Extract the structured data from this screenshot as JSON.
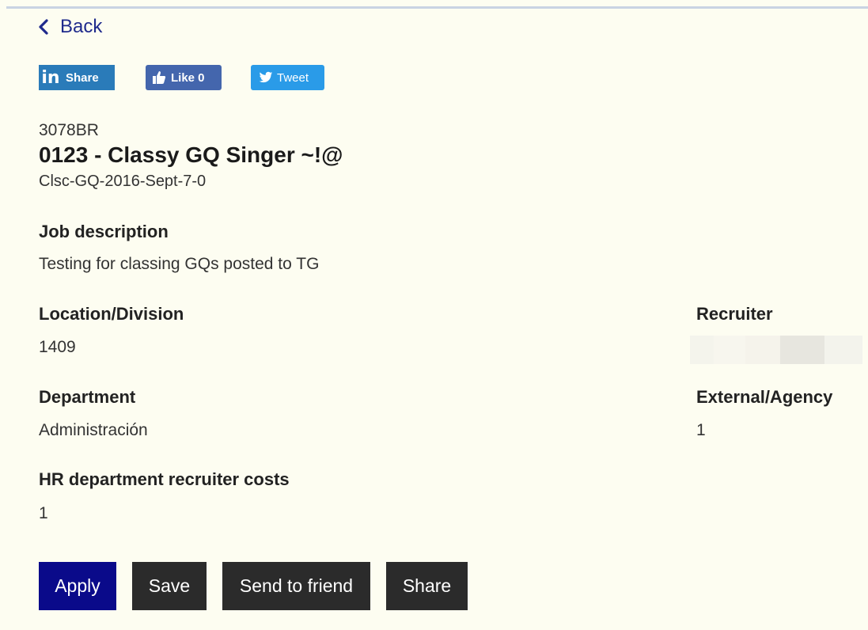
{
  "nav": {
    "back_label": "Back"
  },
  "social": {
    "linkedin_label": "Share",
    "facebook_label": "Like 0",
    "twitter_label": "Tweet",
    "colors": {
      "linkedin": "#2a7bb9",
      "facebook": "#4466ad",
      "twitter": "#2a9be8"
    }
  },
  "job": {
    "code": "3078BR",
    "title": "0123 - Classy GQ Singer ~!@",
    "reference": "Clsc-GQ-2016-Sept-7-0"
  },
  "fields": {
    "job_description": {
      "label": "Job description",
      "value": "Testing for classing GQs posted to TG"
    },
    "location_division": {
      "label": "Location/Division",
      "value": "1409"
    },
    "recruiter": {
      "label": "Recruiter",
      "value": ""
    },
    "department": {
      "label": "Department",
      "value": "Administración"
    },
    "external_agency": {
      "label": "External/Agency",
      "value": "1"
    },
    "hr_costs": {
      "label": "HR department recruiter costs",
      "value": "1"
    }
  },
  "actions": {
    "apply_label": "Apply",
    "save_label": "Save",
    "send_label": "Send to friend",
    "share_label": "Share"
  },
  "colors": {
    "background": "#fdfdf1",
    "link": "#1f2a8c",
    "apply": "#0a0a8a",
    "secondary_button": "#2b2b2b"
  }
}
